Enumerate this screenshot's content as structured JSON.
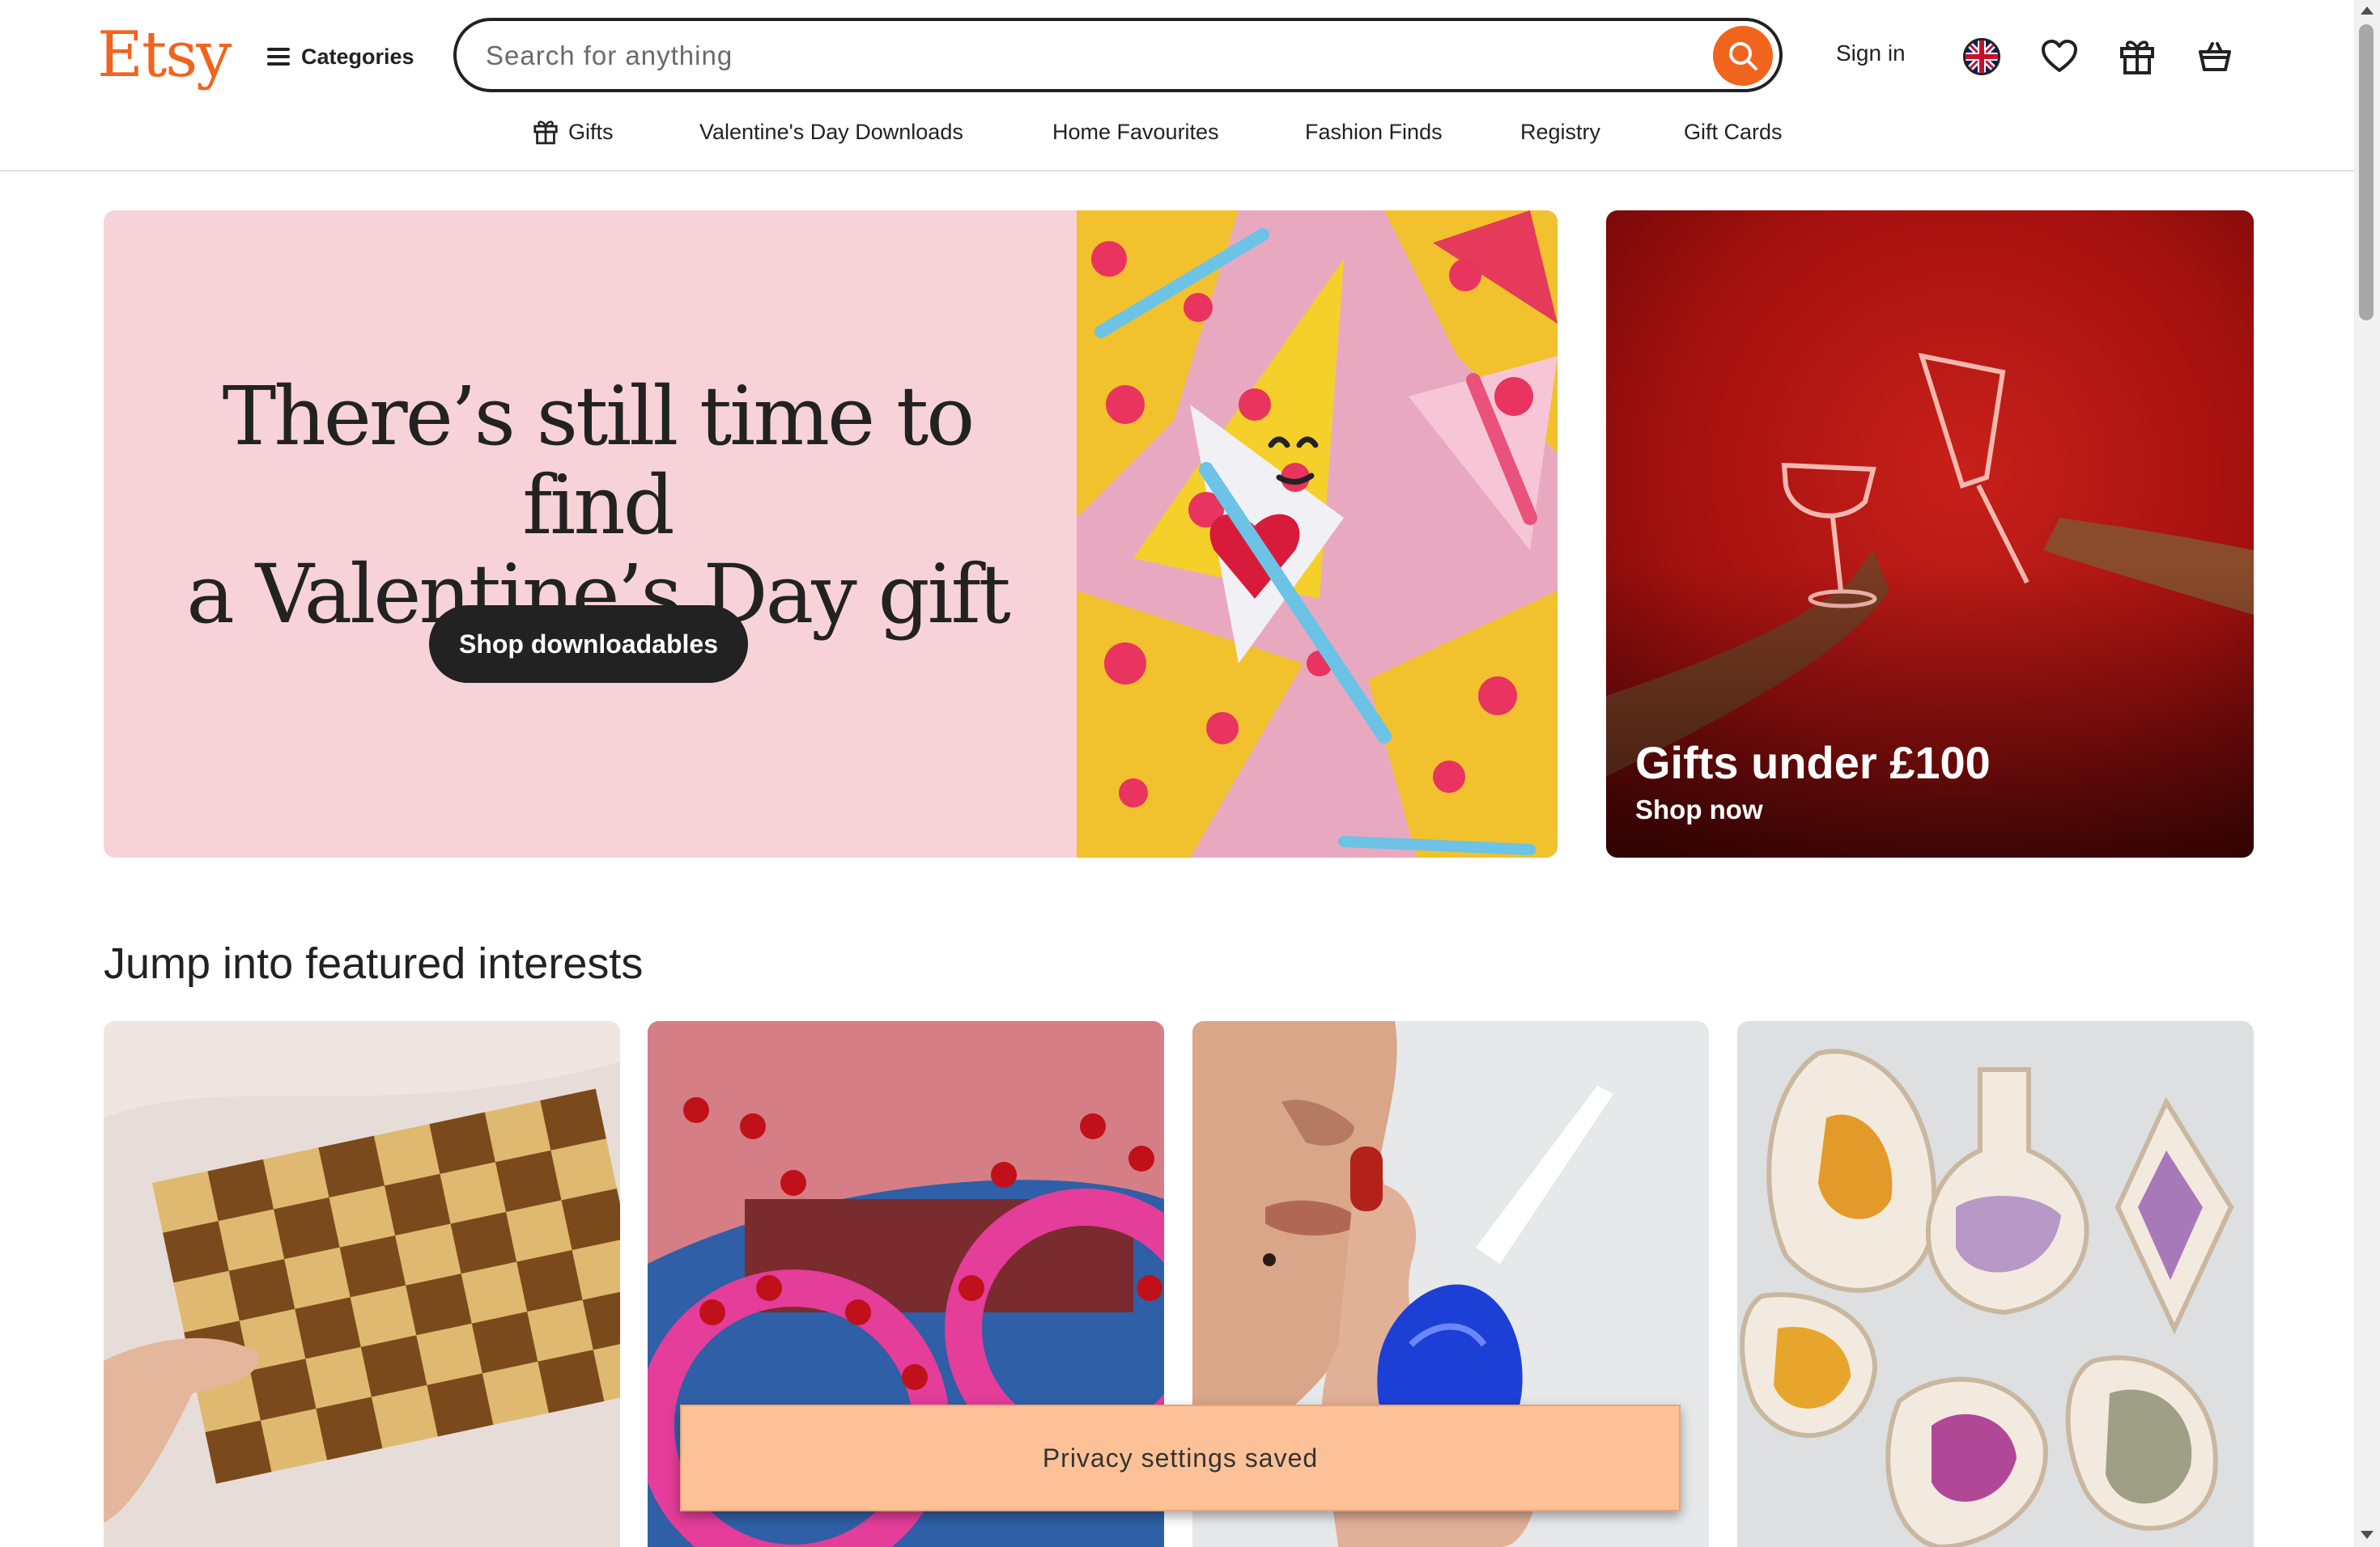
{
  "header": {
    "logo": "Etsy",
    "categories_label": "Categories",
    "search_placeholder": "Search for anything",
    "signin_label": "Sign in"
  },
  "nav": {
    "items": [
      "Gifts",
      "Valentine's Day Downloads",
      "Home Favourites",
      "Fashion Finds",
      "Registry",
      "Gift Cards"
    ]
  },
  "hero": {
    "title_line1": "There’s still time to find",
    "title_line2": "a Valentine’s Day gift",
    "button_label": "Shop downloadables"
  },
  "promo": {
    "title": "Gifts under £100",
    "subtitle": "Shop now"
  },
  "featured": {
    "title": "Jump into featured interests"
  },
  "toast": {
    "message": "Privacy settings saved"
  },
  "colors": {
    "brand": "#f1641e",
    "hero_bg": "#f7d3d9",
    "toast_bg": "#fcc196",
    "promo_bg": "#a3110f"
  },
  "icons": [
    "menu-icon",
    "search-icon",
    "flag-uk-icon",
    "heart-icon",
    "gift-icon",
    "basket-icon",
    "gift-small-icon"
  ]
}
